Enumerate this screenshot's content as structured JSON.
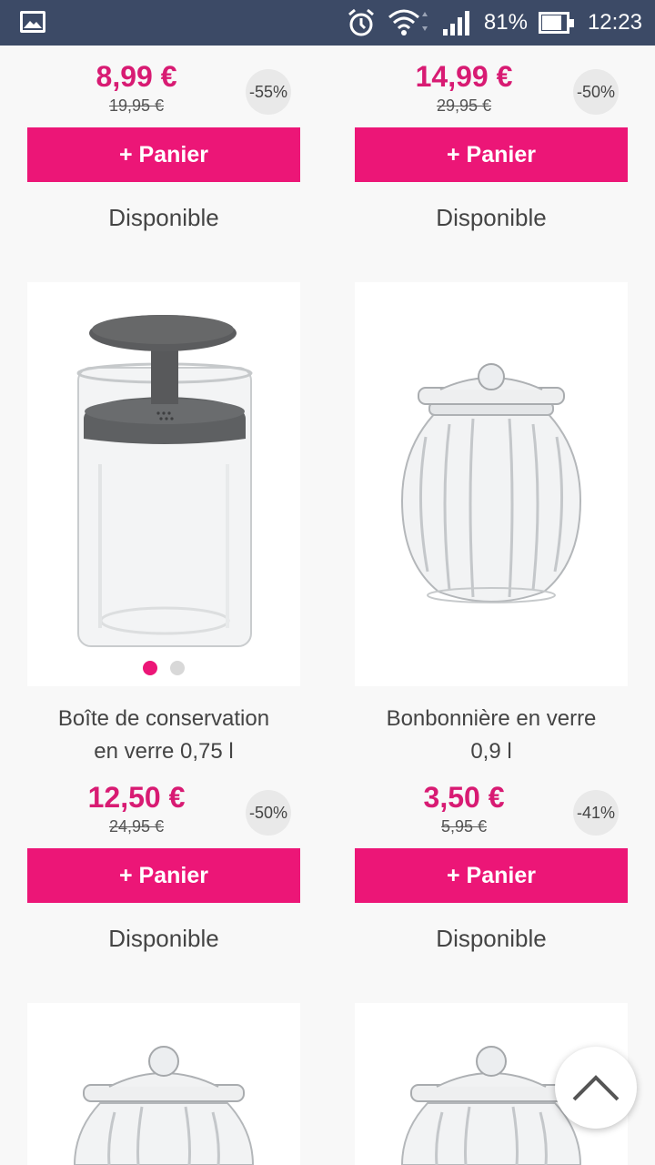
{
  "status_bar": {
    "battery_level": "81%",
    "battery_fraction": 0.81,
    "time": "12:23",
    "icons": [
      "gallery-icon",
      "alarm-icon",
      "wifi-icon",
      "signal-icon",
      "battery-icon"
    ]
  },
  "colors": {
    "accent": "#ec1677",
    "price": "#d81b73",
    "status_bar": "#3c4a66"
  },
  "products_top": [
    {
      "price": "8,99 €",
      "old_price": "19,95 €",
      "discount": "-55%",
      "button": "+ Panier",
      "availability": "Disponible"
    },
    {
      "price": "14,99 €",
      "old_price": "29,95 €",
      "discount": "-50%",
      "button": "+ Panier",
      "availability": "Disponible"
    }
  ],
  "products_mid": [
    {
      "name_line1": "Boîte de conservation",
      "name_line2": "en verre 0,75 l",
      "price": "12,50 €",
      "old_price": "24,95 €",
      "discount": "-50%",
      "button": "+ Panier",
      "availability": "Disponible"
    },
    {
      "name_line1": "Bonbonnière en verre",
      "name_line2": "0,9 l",
      "price": "3,50 €",
      "old_price": "5,95 €",
      "discount": "-41%",
      "button": "+ Panier",
      "availability": "Disponible"
    }
  ],
  "scroll_top_icon": "chevron-up-icon"
}
